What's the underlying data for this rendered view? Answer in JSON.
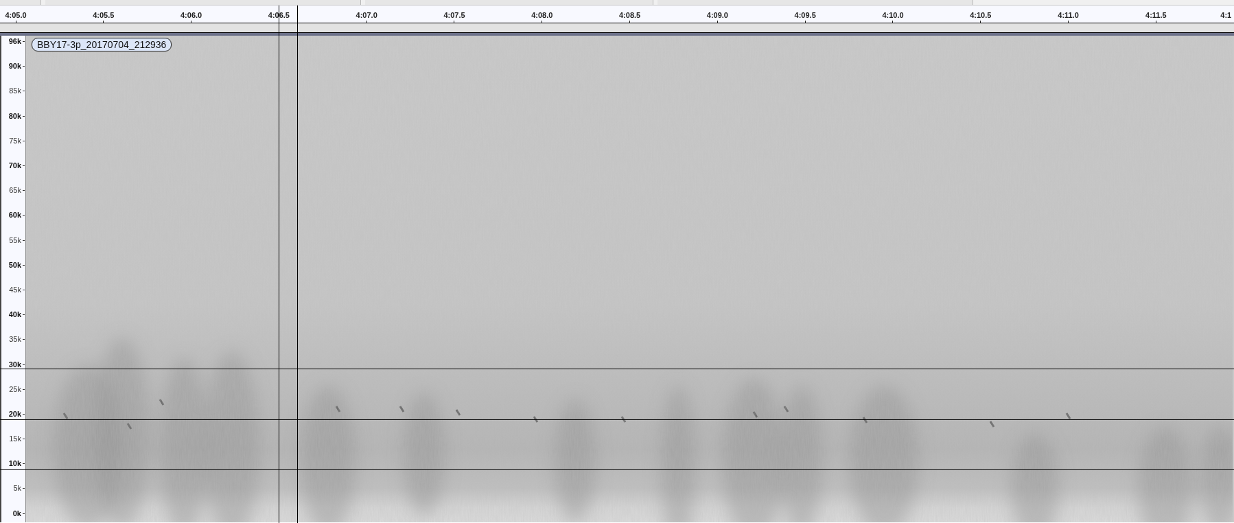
{
  "timeline": {
    "labels": [
      "4:05.0",
      "4:05.5",
      "4:06.0",
      "4:06.5",
      "4:07.0",
      "4:07.5",
      "4:08.0",
      "4:08.5",
      "4:09.0",
      "4:09.5",
      "4:10.0",
      "4:10.5",
      "4:11.0",
      "4:11.5",
      "4:1"
    ]
  },
  "track": {
    "clip_name": "BBY17-3p_20170704_212936",
    "frequency_labels": [
      {
        "label": "96k",
        "major": true
      },
      {
        "label": "90k",
        "major": true
      },
      {
        "label": "85k",
        "major": false
      },
      {
        "label": "80k",
        "major": true
      },
      {
        "label": "75k",
        "major": false
      },
      {
        "label": "70k",
        "major": true
      },
      {
        "label": "65k",
        "major": false
      },
      {
        "label": "60k",
        "major": true
      },
      {
        "label": "55k",
        "major": false
      },
      {
        "label": "50k",
        "major": true
      },
      {
        "label": "45k",
        "major": false
      },
      {
        "label": "40k",
        "major": true
      },
      {
        "label": "35k",
        "major": false
      },
      {
        "label": "30k",
        "major": true
      },
      {
        "label": "25k",
        "major": false
      },
      {
        "label": "20k",
        "major": true
      },
      {
        "label": "15k",
        "major": false
      },
      {
        "label": "10k",
        "major": true
      },
      {
        "label": "5k",
        "major": false
      },
      {
        "label": "0k",
        "major": true
      }
    ]
  }
}
